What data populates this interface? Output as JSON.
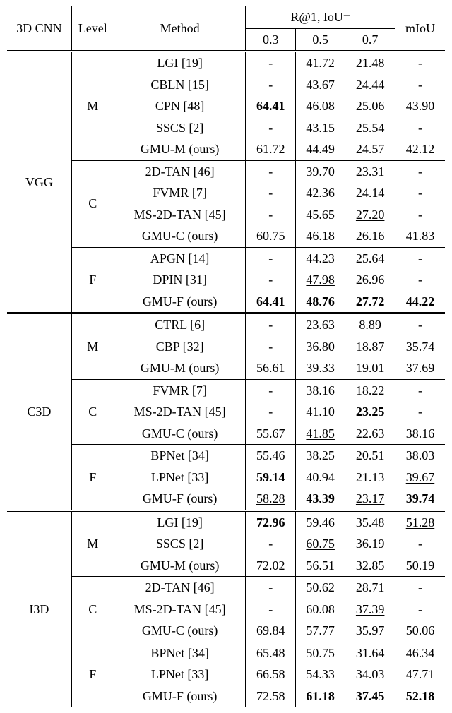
{
  "header": {
    "cnn": "3D CNN",
    "level": "Level",
    "method": "Method",
    "r_at_1": "R@1, IoU=",
    "iou03": "0.3",
    "iou05": "0.5",
    "iou07": "0.7",
    "miou": "mIoU"
  },
  "chart_data": {
    "type": "table",
    "title": "",
    "columns": [
      "3D CNN",
      "Level",
      "Method",
      "R@1 IoU=0.3",
      "R@1 IoU=0.5",
      "R@1 IoU=0.7",
      "mIoU"
    ],
    "blocks": [
      {
        "cnn": "VGG",
        "groups": [
          {
            "level": "M",
            "rows": [
              {
                "method": "LGI [19]",
                "r03": "-",
                "r05": "41.72",
                "r07": "21.48",
                "miou": "-"
              },
              {
                "method": "CBLN [15]",
                "r03": "-",
                "r05": "43.67",
                "r07": "24.44",
                "miou": "-"
              },
              {
                "method": "CPN [48]",
                "r03": "64.41",
                "r05": "46.08",
                "r07": "25.06",
                "miou": "43.90",
                "bold": [
                  "r03"
                ],
                "ul": [
                  "miou"
                ]
              },
              {
                "method": "SSCS [2]",
                "r03": "-",
                "r05": "43.15",
                "r07": "25.54",
                "miou": "-"
              },
              {
                "method": "GMU-M (ours)",
                "r03": "61.72",
                "r05": "44.49",
                "r07": "24.57",
                "miou": "42.12",
                "ul": [
                  "r03"
                ]
              }
            ]
          },
          {
            "level": "C",
            "rows": [
              {
                "method": "2D-TAN [46]",
                "r03": "-",
                "r05": "39.70",
                "r07": "23.31",
                "miou": "-"
              },
              {
                "method": "FVMR [7]",
                "r03": "-",
                "r05": "42.36",
                "r07": "24.14",
                "miou": "-"
              },
              {
                "method": "MS-2D-TAN [45]",
                "r03": "-",
                "r05": "45.65",
                "r07": "27.20",
                "miou": "-",
                "ul": [
                  "r07"
                ]
              },
              {
                "method": "GMU-C (ours)",
                "r03": "60.75",
                "r05": "46.18",
                "r07": "26.16",
                "miou": "41.83"
              }
            ]
          },
          {
            "level": "F",
            "rows": [
              {
                "method": "APGN [14]",
                "r03": "-",
                "r05": "44.23",
                "r07": "25.64",
                "miou": "-"
              },
              {
                "method": "DPIN [31]",
                "r03": "-",
                "r05": "47.98",
                "r07": "26.96",
                "miou": "-",
                "ul": [
                  "r05"
                ]
              },
              {
                "method": "GMU-F (ours)",
                "r03": "64.41",
                "r05": "48.76",
                "r07": "27.72",
                "miou": "44.22",
                "bold": [
                  "r03",
                  "r05",
                  "r07",
                  "miou"
                ]
              }
            ]
          }
        ]
      },
      {
        "cnn": "C3D",
        "groups": [
          {
            "level": "M",
            "rows": [
              {
                "method": "CTRL [6]",
                "r03": "-",
                "r05": "23.63",
                "r07": "8.89",
                "miou": "-"
              },
              {
                "method": "CBP [32]",
                "r03": "-",
                "r05": "36.80",
                "r07": "18.87",
                "miou": "35.74"
              },
              {
                "method": "GMU-M (ours)",
                "r03": "56.61",
                "r05": "39.33",
                "r07": "19.01",
                "miou": "37.69"
              }
            ]
          },
          {
            "level": "C",
            "rows": [
              {
                "method": "FVMR [7]",
                "r03": "-",
                "r05": "38.16",
                "r07": "18.22",
                "miou": "-"
              },
              {
                "method": "MS-2D-TAN [45]",
                "r03": "-",
                "r05": "41.10",
                "r07": "23.25",
                "miou": "-",
                "bold": [
                  "r07"
                ]
              },
              {
                "method": "GMU-C (ours)",
                "r03": "55.67",
                "r05": "41.85",
                "r07": "22.63",
                "miou": "38.16",
                "ul": [
                  "r05"
                ]
              }
            ]
          },
          {
            "level": "F",
            "rows": [
              {
                "method": "BPNet [34]",
                "r03": "55.46",
                "r05": "38.25",
                "r07": "20.51",
                "miou": "38.03"
              },
              {
                "method": "LPNet [33]",
                "r03": "59.14",
                "r05": "40.94",
                "r07": "21.13",
                "miou": "39.67",
                "bold": [
                  "r03"
                ],
                "ul": [
                  "miou"
                ]
              },
              {
                "method": "GMU-F (ours)",
                "r03": "58.28",
                "r05": "43.39",
                "r07": "23.17",
                "miou": "39.74",
                "bold": [
                  "r05",
                  "miou"
                ],
                "ul": [
                  "r03",
                  "r07"
                ]
              }
            ]
          }
        ]
      },
      {
        "cnn": "I3D",
        "groups": [
          {
            "level": "M",
            "rows": [
              {
                "method": "LGI [19]",
                "r03": "72.96",
                "r05": "59.46",
                "r07": "35.48",
                "miou": "51.28",
                "bold": [
                  "r03"
                ],
                "ul": [
                  "miou"
                ]
              },
              {
                "method": "SSCS [2]",
                "r03": "-",
                "r05": "60.75",
                "r07": "36.19",
                "miou": "-",
                "ul": [
                  "r05"
                ]
              },
              {
                "method": "GMU-M (ours)",
                "r03": "72.02",
                "r05": "56.51",
                "r07": "32.85",
                "miou": "50.19"
              }
            ]
          },
          {
            "level": "C",
            "rows": [
              {
                "method": "2D-TAN [46]",
                "r03": "-",
                "r05": "50.62",
                "r07": "28.71",
                "miou": "-"
              },
              {
                "method": "MS-2D-TAN [45]",
                "r03": "-",
                "r05": "60.08",
                "r07": "37.39",
                "miou": "-",
                "ul": [
                  "r07"
                ]
              },
              {
                "method": "GMU-C (ours)",
                "r03": "69.84",
                "r05": "57.77",
                "r07": "35.97",
                "miou": "50.06"
              }
            ]
          },
          {
            "level": "F",
            "rows": [
              {
                "method": "BPNet [34]",
                "r03": "65.48",
                "r05": "50.75",
                "r07": "31.64",
                "miou": "46.34"
              },
              {
                "method": "LPNet [33]",
                "r03": "66.58",
                "r05": "54.33",
                "r07": "34.03",
                "miou": "47.71"
              },
              {
                "method": "GMU-F (ours)",
                "r03": "72.58",
                "r05": "61.18",
                "r07": "37.45",
                "miou": "52.18",
                "bold": [
                  "r05",
                  "r07",
                  "miou"
                ],
                "ul": [
                  "r03"
                ]
              }
            ]
          }
        ]
      }
    ]
  }
}
